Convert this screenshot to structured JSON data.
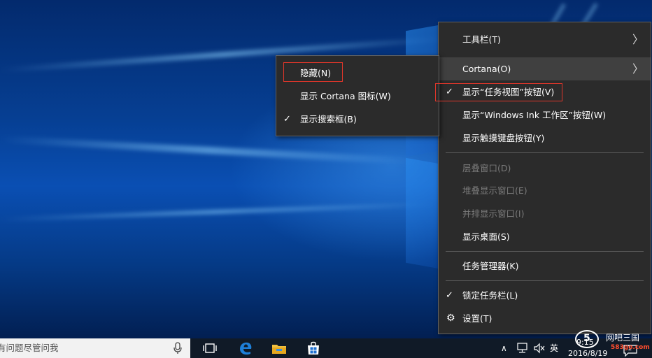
{
  "desktop": {},
  "context_menu": {
    "items": [
      {
        "label": "工具栏(T)",
        "has_submenu": true,
        "checked": false,
        "enabled": true
      },
      {
        "label": "Cortana(O)",
        "has_submenu": true,
        "checked": false,
        "enabled": true,
        "highlighted": true
      },
      {
        "label": "显示“任务视图”按钮(V)",
        "checked": true,
        "enabled": true
      },
      {
        "label": "显示“Windows Ink 工作区”按钮(W)",
        "checked": false,
        "enabled": true
      },
      {
        "label": "显示触摸键盘按钮(Y)",
        "checked": false,
        "enabled": true
      },
      {
        "label": "层叠窗口(D)",
        "checked": false,
        "enabled": false
      },
      {
        "label": "堆叠显示窗口(E)",
        "checked": false,
        "enabled": false
      },
      {
        "label": "并排显示窗口(I)",
        "checked": false,
        "enabled": false
      },
      {
        "label": "显示桌面(S)",
        "checked": false,
        "enabled": true
      },
      {
        "label": "任务管理器(K)",
        "checked": false,
        "enabled": true
      },
      {
        "label": "锁定任务栏(L)",
        "checked": true,
        "enabled": true
      },
      {
        "label": "设置(T)",
        "checked": false,
        "enabled": true
      }
    ]
  },
  "cortana_submenu": {
    "items": [
      {
        "label": "隐藏(N)",
        "checked": false
      },
      {
        "label": "显示 Cortana 图标(W)",
        "checked": false
      },
      {
        "label": "显示搜索框(B)",
        "checked": true
      }
    ]
  },
  "icons": {
    "check": "✓",
    "submenu_arrow": "〉",
    "settings": "⚙"
  },
  "taskbar": {
    "search_text": "有问题尽管问我",
    "tray": {
      "chevron": "∧",
      "ime": "英",
      "time_partial": "9:15",
      "date": "2016/8/19",
      "notifications": "1"
    }
  },
  "watermark": {
    "logo_digit": "5",
    "brand": "网吧三国",
    "url": "583go.com"
  },
  "colors": {
    "menu_bg": "#2b2b2b",
    "highlight_box": "#e0362a",
    "taskbar_bg": "#101a27",
    "edge_blue": "#1e7fd8",
    "store_blue": "#1e6fd0",
    "explorer_yellow": "#f0c040"
  }
}
